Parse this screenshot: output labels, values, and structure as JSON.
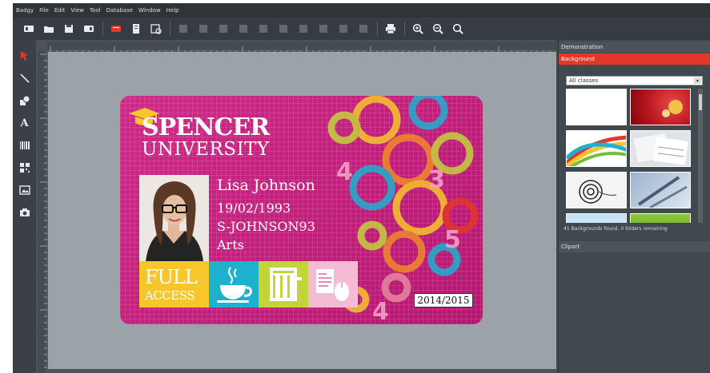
{
  "app": {
    "menu": [
      "Badgy",
      "File",
      "Edit",
      "View",
      "Tool",
      "Database",
      "Window",
      "Help"
    ]
  },
  "toolbar": {
    "icons": [
      "new-card-icon",
      "open-folder-icon",
      "save-icon",
      "save-as-icon",
      "print-preview-icon",
      "card-properties-icon",
      "database-icon",
      "print-icon",
      "zoom-in-icon",
      "zoom-out-icon",
      "zoom-fit-icon"
    ]
  },
  "tools": {
    "text_tool": "A"
  },
  "card": {
    "university_line1": "SPENCER",
    "university_line2": "UNIVERSITY",
    "holder_name": "Lisa Johnson",
    "birth_date": "19/02/1993",
    "student_id": "S-JOHNSON93",
    "department": "Arts",
    "access_line1": "FULL",
    "access_line2": "ACCESS",
    "academic_year": "2014/2015",
    "colors": {
      "background": "#c41f7c",
      "yellow": "#f6c62a",
      "cyan": "#1eb1cf",
      "lime": "#c3d33c",
      "pink": "#f3bcd4"
    }
  },
  "panel": {
    "demonstration_header": "Demonstration",
    "background_header": "Background",
    "filter_value": "All classes",
    "status": "41 Backgrounds found, 0 folders remaining",
    "clipart_header": "Clipart",
    "accent": "#e2372b"
  }
}
